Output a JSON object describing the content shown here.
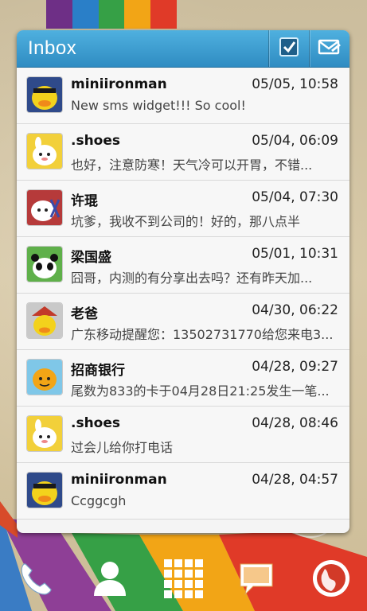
{
  "widget": {
    "title": "Inbox",
    "check_icon": "checkbox-icon",
    "compose_icon": "compose-envelope-icon"
  },
  "messages": [
    {
      "sender": "miniironman",
      "date": "05/05, 10:58",
      "snippet": "New sms widget!!! So cool!",
      "avatar": "yellow-duck-avatar"
    },
    {
      "sender": ".shoes",
      "date": "05/04, 06:09",
      "snippet": "也好，注意防寒！天气冷可以开胃，不错...",
      "avatar": "white-bunny-avatar"
    },
    {
      "sender": "许琨",
      "date": "05/04, 07:30",
      "snippet": "坑爹，我收不到公司的！好的，那八点半",
      "avatar": "bunny-scissors-avatar"
    },
    {
      "sender": "梁国盛",
      "date": "05/01, 10:31",
      "snippet": "囧哥，内测的有分享出去吗？还有昨天加...",
      "avatar": "panda-avatar"
    },
    {
      "sender": "老爸",
      "date": "04/30, 06:22",
      "snippet": "广东移动提醒您：13502731770给您来电3...",
      "avatar": "duck-hat-avatar"
    },
    {
      "sender": "招商银行",
      "date": "04/28, 09:27",
      "snippet": "尾数为833的卡于04月28日21:25发生一笔...",
      "avatar": "orange-head-avatar"
    },
    {
      "sender": ".shoes",
      "date": "04/28, 08:46",
      "snippet": "过会儿给你打电话",
      "avatar": "white-bunny-avatar"
    },
    {
      "sender": "miniironman",
      "date": "04/28, 04:57",
      "snippet": "Ccggcgh",
      "avatar": "yellow-duck-avatar"
    }
  ],
  "dock": [
    "phone-icon",
    "contacts-icon",
    "app-drawer-icon",
    "messaging-icon",
    "browser-icon"
  ],
  "colors": {
    "header_top": "#4fb0df",
    "header_bottom": "#2f8cc2",
    "stripe_colors": [
      "#7a2f8c",
      "#2d7fc4",
      "#3aa04a",
      "#f0a21a",
      "#e23a2a"
    ]
  }
}
